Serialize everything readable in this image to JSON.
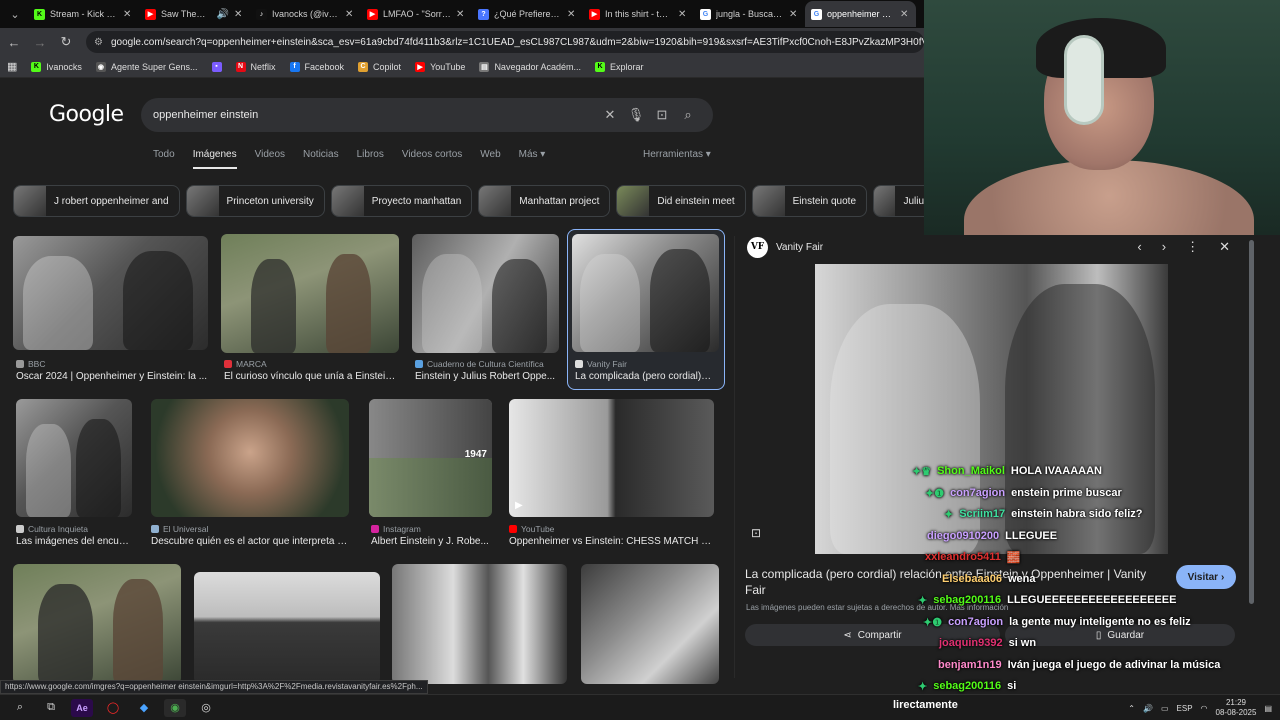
{
  "tabs": [
    {
      "title": "Stream - Kick Dashboard",
      "fav_color": "#53fc18",
      "fav_glyph": "K"
    },
    {
      "title": "Saw Theme S",
      "fav_color": "#ff0000",
      "fav_glyph": "▶"
    },
    {
      "title": "Ivanocks (@ivanocks)",
      "fav_color": "#111111",
      "fav_glyph": "♪"
    },
    {
      "title": "LMFAO - \"Sorry F",
      "fav_color": "#ff0000",
      "fav_glyph": "▶"
    },
    {
      "title": "¿Qué Prefieres? ¡J",
      "fav_color": "#4a76ff",
      "fav_glyph": "?"
    },
    {
      "title": "In this shirt - the i",
      "fav_color": "#ff0000",
      "fav_glyph": "▶"
    },
    {
      "title": "jungla - Buscar co",
      "fav_color": "#ffffff",
      "fav_glyph": "G"
    },
    {
      "title": "oppenheimer einst",
      "fav_color": "#ffffff",
      "fav_glyph": "G"
    }
  ],
  "address": {
    "url": "google.com/search?q=oppenheimer+einstein&sca_esv=61a9cbd74fd411b3&rlz=1C1UEAD_esCL987CL987&udm=2&biw=1920&bih=919&sxsrf=AE3TifPxcf0Cnoh-E8JPvZkazMP3H0fVaQ%3A1754702"
  },
  "bookmarks": [
    {
      "label": "Ivanocks",
      "color": "#53fc18",
      "glyph": "K"
    },
    {
      "label": "Agente Super Gens...",
      "color": "#555555",
      "glyph": "◉"
    },
    {
      "label": "",
      "color": "#7b5cff",
      "glyph": "▪"
    },
    {
      "label": "Netflix",
      "color": "#e50914",
      "glyph": "N"
    },
    {
      "label": "Facebook",
      "color": "#1877f2",
      "glyph": "f"
    },
    {
      "label": "Copilot",
      "color": "#e0a030",
      "glyph": "C"
    },
    {
      "label": "YouTube",
      "color": "#ff0000",
      "glyph": "▶"
    },
    {
      "label": "Navegador Académ...",
      "color": "#777777",
      "glyph": "▤"
    },
    {
      "label": "Explorar",
      "color": "#53fc18",
      "glyph": "K"
    }
  ],
  "google": {
    "logo": "Google",
    "query": "oppenheimer einstein",
    "tabs": [
      "Todo",
      "Imágenes",
      "Videos",
      "Noticias",
      "Libros",
      "Videos cortos",
      "Web",
      "Más ▾"
    ],
    "tools": "Herramientas ▾"
  },
  "chips": [
    "J robert oppenheimer and",
    "Princeton university",
    "Proyecto manhattan",
    "Manhattan project",
    "Did einstein meet",
    "Einstein quote",
    "Julius"
  ],
  "results": [
    {
      "source": "BBC",
      "caption": "Oscar 2024 | Oppenheimer y Einstein: la ...",
      "src_color": "#999999"
    },
    {
      "source": "MARCA",
      "caption": "El curioso vínculo que unía a Einstein...",
      "src_color": "#e0303a"
    },
    {
      "source": "Cuaderno de Cultura Científica",
      "caption": "Einstein y Julius Robert Oppe...",
      "src_color": "#5aa0e0"
    },
    {
      "source": "Vanity Fair",
      "caption": "La complicada (pero cordial) r...",
      "src_color": "#dddddd"
    },
    {
      "source": "Cultura Inquieta",
      "caption": "Las imágenes del encue...",
      "src_color": "#cccccc"
    },
    {
      "source": "El Universal",
      "caption": "Descubre quién es el actor que interpreta a ...",
      "src_color": "#8fb0d0"
    },
    {
      "source": "Instagram",
      "caption": "Albert Einstein y J. Robe...",
      "src_color": "#d6249f"
    },
    {
      "source": "YouTube",
      "caption": "Oppenheimer vs Einstein: CHESS MATCH - Y...",
      "src_color": "#ff0000"
    }
  ],
  "thumb_year": "1947",
  "preview": {
    "source": "Vanity Fair",
    "logo": "VF",
    "title": "La complicada (pero cordial) relación entre Einstein y Oppenheimer | Vanity Fair",
    "visit": "Visitar",
    "note": "Las imágenes pueden estar sujetas a derechos de autor. Más información",
    "share": "Compartir",
    "save": "Guardar"
  },
  "chat": [
    {
      "user": "Shon_Maikol",
      "text": "HOLA IVAAAAAN",
      "color": "#53fc18",
      "prefix": "✦♛"
    },
    {
      "user": "con7agion",
      "text": "enstein prime buscar",
      "color": "#c9a0ff",
      "prefix": "✦❶"
    },
    {
      "user": "Scriim17",
      "text": "einstein habra sido feliz?",
      "color": "#3fe0a0",
      "prefix": "✦"
    },
    {
      "user": "diego0910200",
      "text": "LLEGUEE",
      "color": "#c9a0ff",
      "prefix": ""
    },
    {
      "user": "xxleandro5411",
      "text": "🧱",
      "color": "#e03030",
      "prefix": ""
    },
    {
      "user": "Elsebaaa06",
      "text": "wena",
      "color": "#ffcf70",
      "prefix": ""
    },
    {
      "user": "sebag200116",
      "text": "LLEGUEEEEEEEEEEEEEEEEEE",
      "color": "#53fc18",
      "prefix": "✦"
    },
    {
      "user": "con7agion",
      "text": "la gente muy inteligente no es feliz",
      "color": "#c9a0ff",
      "prefix": "✦❶"
    },
    {
      "user": "joaquin9392",
      "text": "si wn",
      "color": "#e03070",
      "prefix": ""
    },
    {
      "user": "benjam1n19",
      "text": "Iván juega el juego de adivinar la música",
      "color": "#ff8acb",
      "prefix": ""
    },
    {
      "user": "sebag200116",
      "text": "si",
      "color": "#53fc18",
      "prefix": "✦"
    }
  ],
  "status_url": "https://www.google.com/imgres?q=oppenheimer einstein&imgurl=http%3A%2F%2Fmedia.revistavanityfair.es%2Fph...",
  "subtitle": "lirectamente",
  "taskbar": {
    "lang": "ESP",
    "time": "21:29",
    "date": "08-08-2025"
  }
}
